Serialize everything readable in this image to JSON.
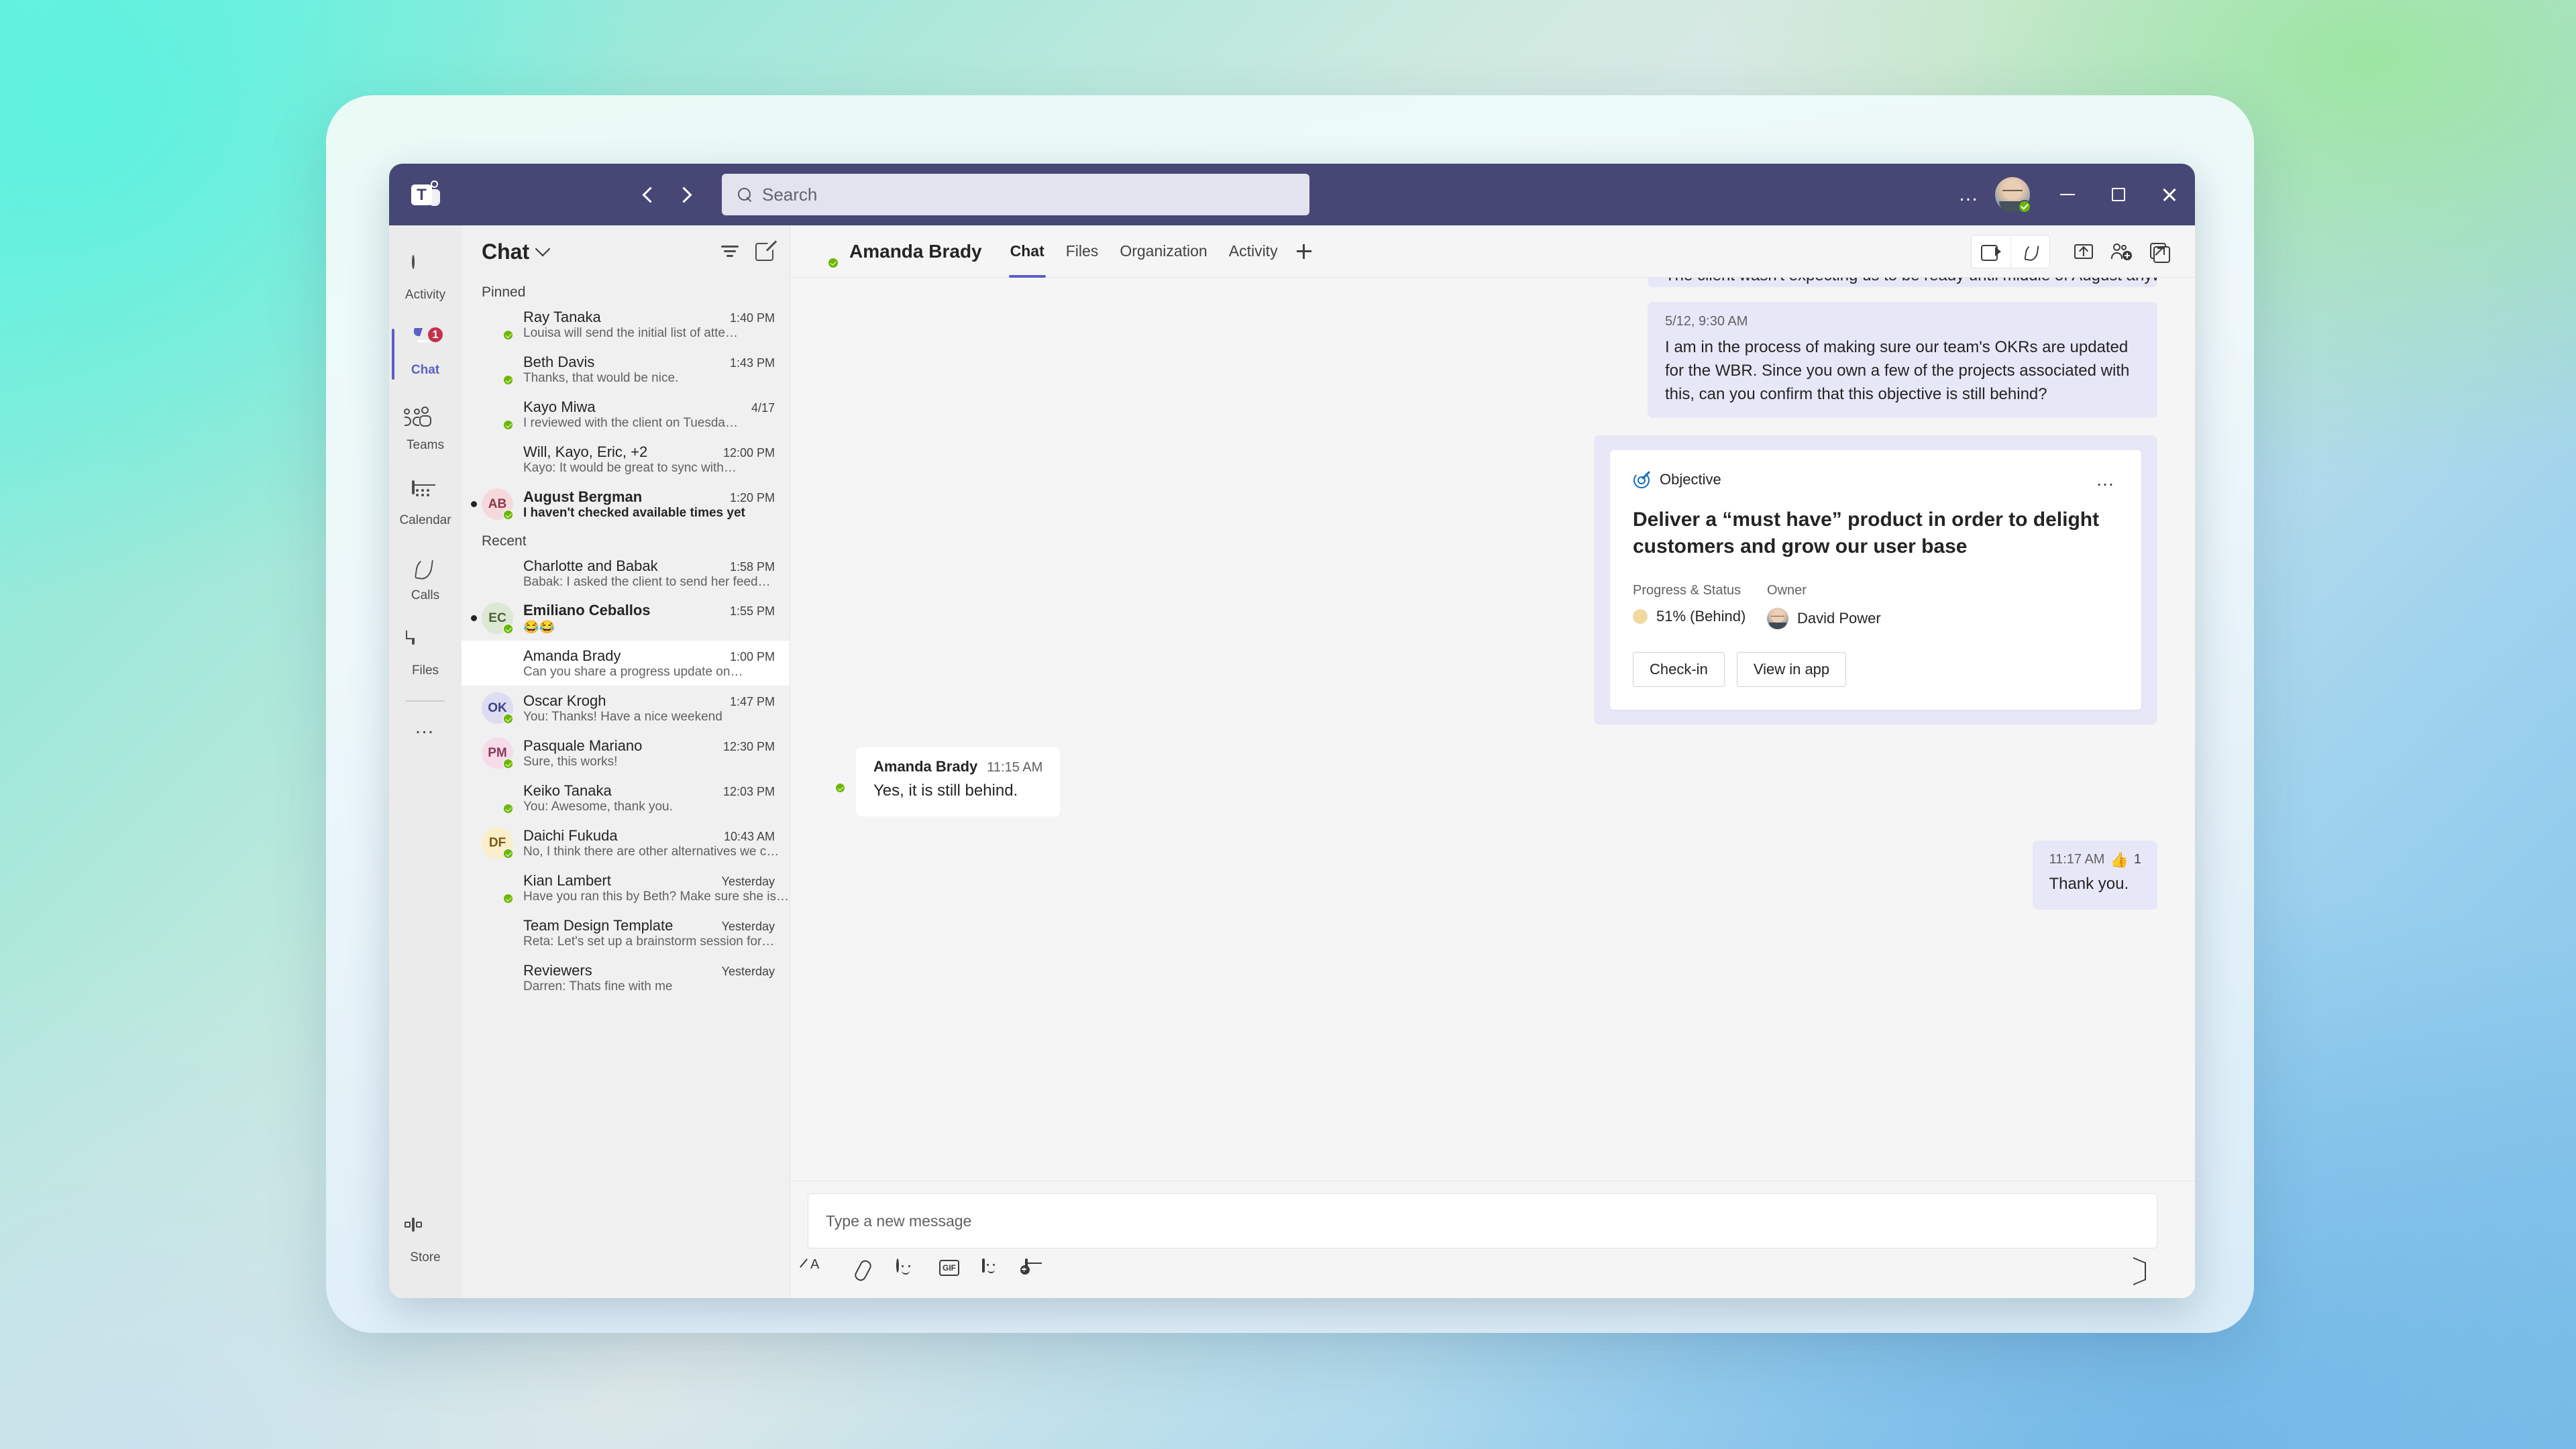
{
  "titlebar": {
    "app_logo": "teams-logo",
    "back_label": "Back",
    "forward_label": "Forward",
    "search_placeholder": "Search",
    "more_label": "…",
    "minimize_label": "Minimize",
    "maximize_label": "Maximize",
    "close_label": "Close",
    "brand_color": "#464775"
  },
  "rail": {
    "items": [
      {
        "label": "Activity",
        "icon": "activity-icon",
        "badge": null,
        "active": false
      },
      {
        "label": "Chat",
        "icon": "chat-icon",
        "badge": "1",
        "active": true
      },
      {
        "label": "Teams",
        "icon": "teams-icon",
        "badge": null,
        "active": false
      },
      {
        "label": "Calendar",
        "icon": "calendar-icon",
        "badge": null,
        "active": false
      },
      {
        "label": "Calls",
        "icon": "calls-icon",
        "badge": null,
        "active": false
      },
      {
        "label": "Files",
        "icon": "files-icon",
        "badge": null,
        "active": false
      }
    ],
    "more_label": "…",
    "store": {
      "label": "Store",
      "icon": "store-icon"
    }
  },
  "chat_list": {
    "title": "Chat",
    "filter_label": "Filter",
    "compose_label": "New chat",
    "groups": [
      {
        "label": "Pinned",
        "items": [
          {
            "name": "Ray Tanaka",
            "time": "1:40 PM",
            "preview": "Louisa will send the initial list of atte…",
            "unread": false,
            "avatar": "photo-ray",
            "initials": "",
            "presence": "available"
          },
          {
            "name": "Beth Davis",
            "time": "1:43 PM",
            "preview": "Thanks, that would be nice.",
            "unread": false,
            "avatar": "photo-beth",
            "initials": "",
            "presence": "available"
          },
          {
            "name": "Kayo Miwa",
            "time": "4/17",
            "preview": "I reviewed with the client on Tuesda…",
            "unread": false,
            "avatar": "photo-kayo",
            "initials": "",
            "presence": "available"
          },
          {
            "name": "Will, Kayo, Eric, +2",
            "time": "12:00 PM",
            "preview": "Kayo: It would be great to sync with…",
            "unread": false,
            "avatar": "photo-group",
            "initials": "",
            "presence": "none"
          },
          {
            "name": "August Bergman",
            "time": "1:20 PM",
            "preview": "I haven't checked available times yet",
            "unread": true,
            "avatar": "initials",
            "initials": "AB",
            "presence": "available"
          }
        ]
      },
      {
        "label": "Recent",
        "items": [
          {
            "name": "Charlotte and Babak",
            "time": "1:58 PM",
            "preview": "Babak: I asked the client to send her feed…",
            "unread": false,
            "avatar": "photo-group2",
            "initials": "",
            "presence": "none"
          },
          {
            "name": "Emiliano Ceballos",
            "time": "1:55 PM",
            "preview": "😂😂",
            "unread": true,
            "avatar": "initials",
            "initials": "EC",
            "presence": "available"
          },
          {
            "name": "Amanda Brady",
            "time": "1:00 PM",
            "preview": "Can you share a progress update on…",
            "unread": false,
            "avatar": "photo-amanda",
            "initials": "",
            "presence": "none",
            "selected": true
          },
          {
            "name": "Oscar Krogh",
            "time": "1:47 PM",
            "preview": "You: Thanks! Have a nice weekend",
            "unread": false,
            "avatar": "initials",
            "initials": "OK",
            "presence": "available"
          },
          {
            "name": "Pasquale Mariano",
            "time": "12:30 PM",
            "preview": "Sure, this works!",
            "unread": false,
            "avatar": "initials",
            "initials": "PM",
            "presence": "available"
          },
          {
            "name": "Keiko Tanaka",
            "time": "12:03 PM",
            "preview": "You: Awesome, thank you.",
            "unread": false,
            "avatar": "photo-keiko",
            "initials": "",
            "presence": "available"
          },
          {
            "name": "Daichi Fukuda",
            "time": "10:43 AM",
            "preview": "No, I think there are other alternatives we c…",
            "unread": false,
            "avatar": "initials",
            "initials": "DF",
            "presence": "available"
          },
          {
            "name": "Kian Lambert",
            "time": "Yesterday",
            "preview": "Have you ran this by Beth? Make sure she is…",
            "unread": false,
            "avatar": "photo-kian",
            "initials": "",
            "presence": "available"
          },
          {
            "name": "Team Design Template",
            "time": "Yesterday",
            "preview": "Reta: Let's set up a brainstorm session for…",
            "unread": false,
            "avatar": "photo-group3",
            "initials": "",
            "presence": "none"
          },
          {
            "name": "Reviewers",
            "time": "Yesterday",
            "preview": "Darren: Thats fine with me",
            "unread": false,
            "avatar": "photo-group4",
            "initials": "",
            "presence": "none"
          }
        ]
      }
    ]
  },
  "chat_header": {
    "contact_name": "Amanda Brady",
    "presence": "available",
    "tabs": [
      {
        "label": "Chat",
        "active": true
      },
      {
        "label": "Files",
        "active": false
      },
      {
        "label": "Organization",
        "active": false
      },
      {
        "label": "Activity",
        "active": false
      }
    ],
    "add_tab_label": "+",
    "actions": [
      {
        "name": "video-call",
        "icon": "video-icon"
      },
      {
        "name": "audio-call",
        "icon": "phone-icon"
      },
      {
        "name": "share-screen",
        "icon": "share-screen-icon"
      },
      {
        "name": "add-people",
        "icon": "add-user-icon"
      },
      {
        "name": "pop-out",
        "icon": "pop-out-icon"
      }
    ]
  },
  "messages": {
    "clipped_top": "The client wasn't expecting us to be ready until middle of August anyways",
    "outgoing_1": {
      "time": "5/12, 9:30 AM",
      "text": "I am in the process of making sure our team's OKRs are updated for the WBR. Since you own a few of the projects associated with this, can you confirm that this objective is still behind?"
    },
    "card": {
      "kind": "Objective",
      "more_label": "…",
      "title": "Deliver a “must have” product in order to delight customers and grow our user base",
      "progress_label": "Progress & Status",
      "progress_value": "51% (Behind)",
      "progress_color": "#f2d9a0",
      "owner_label": "Owner",
      "owner_name": "David Power",
      "buttons": [
        {
          "label": "Check-in"
        },
        {
          "label": "View in app"
        }
      ]
    },
    "incoming_1": {
      "sender": "Amanda Brady",
      "time": "11:15 AM",
      "text": "Yes, it is still behind."
    },
    "outgoing_2": {
      "time": "11:17 AM",
      "text": "Thank you.",
      "reaction_emoji": "👍",
      "reaction_count": "1"
    }
  },
  "composer": {
    "placeholder": "Type a new message",
    "tools": [
      {
        "name": "format-icon",
        "label": "Format"
      },
      {
        "name": "attach-icon",
        "label": "Attach"
      },
      {
        "name": "emoji-icon",
        "label": "Emoji"
      },
      {
        "name": "gif-icon",
        "label": "GIF"
      },
      {
        "name": "sticker-icon",
        "label": "Sticker"
      },
      {
        "name": "meet-now-icon",
        "label": "Meet now"
      }
    ],
    "send_label": "Send"
  }
}
